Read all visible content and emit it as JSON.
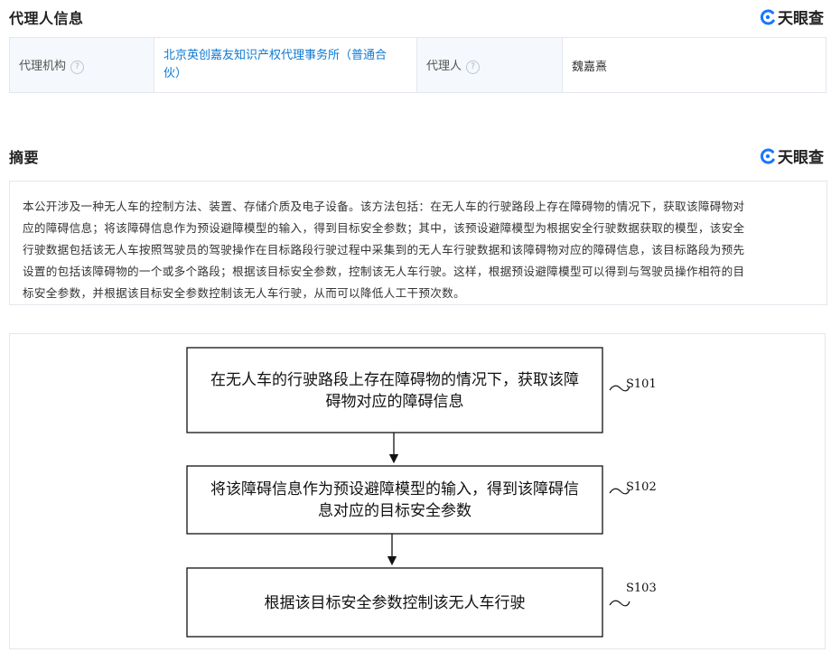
{
  "agent_section": {
    "title": "代理人信息",
    "brand": "天眼查",
    "agency_label": "代理机构",
    "agency_value_line1": "北京英创嘉友知识产权代理事务所（普通合",
    "agency_value_line2": "伙）",
    "agent_label": "代理人",
    "agent_value": "魏嘉熹",
    "help_glyph": "?"
  },
  "abstract_section": {
    "title": "摘要",
    "brand": "天眼查",
    "lines": [
      "本公开涉及一种无人车的控制方法、装置、存储介质及电子设备。该方法包括：在无人车的行驶路段上存在障碍物的情况下，获取该障碍物对",
      "应的障碍信息；将该障碍信息作为预设避障模型的输入，得到目标安全参数；其中，该预设避障模型为根据安全行驶数据获取的模型，该安全",
      "行驶数据包括该无人车按照驾驶员的驾驶操作在目标路段行驶过程中采集到的无人车行驶数据和该障碍物对应的障碍信息，该目标路段为预先",
      "设置的包括该障碍物的一个或多个路段；根据该目标安全参数，控制该无人车行驶。这样，根据预设避障模型可以得到与驾驶员操作相符的目",
      "标安全参数，并根据该目标安全参数控制该无人车行驶，从而可以降低人工干预次数。"
    ]
  },
  "flowchart": {
    "steps": [
      {
        "label": "S101",
        "line1": "在无人车的行驶路段上存在障碍物的情况下，获取该障",
        "line2": "碍物对应的障碍信息"
      },
      {
        "label": "S102",
        "line1": "将该障碍信息作为预设避障模型的输入，得到该障碍信",
        "line2": "息对应的目标安全参数"
      },
      {
        "label": "S103",
        "line1": "根据该目标安全参数控制该无人车行驶",
        "line2": ""
      }
    ]
  },
  "colors": {
    "link": "#0e7ad4",
    "brand_icon": "#1677ff",
    "label_bg": "#f5f8fc",
    "border": "#e3e7ee"
  },
  "icons": {
    "brand": "tianyancha-logo-icon",
    "help": "help-circle-icon"
  }
}
